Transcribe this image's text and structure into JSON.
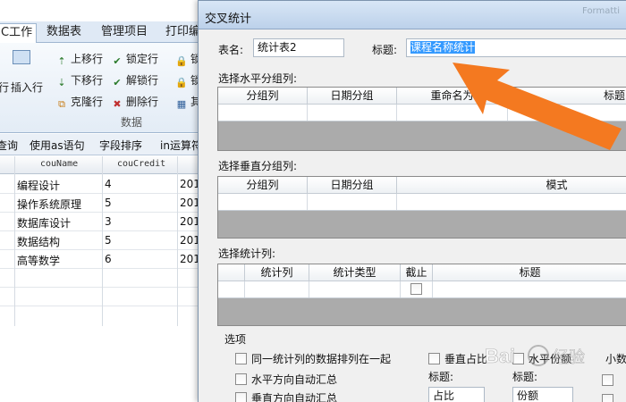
{
  "bg_app": {
    "tabs": [
      "C工作",
      "数据表",
      "管理项目",
      "打印编"
    ],
    "ribbon_left": [
      "行",
      "插入行"
    ],
    "ribbon_col1": [
      "上移行",
      "下移行",
      "克隆行"
    ],
    "ribbon_col2": [
      "锁定行",
      "解锁行",
      "删除行"
    ],
    "ribbon_col3": [
      "锁",
      "锁",
      "其"
    ],
    "ribbon_group_label": "数据",
    "query_bar": [
      "查询",
      "使用as语句",
      "字段排序",
      "in运算符"
    ],
    "grid_headers": [
      "couName",
      "couCredit"
    ],
    "rows": [
      {
        "name": "编程设计",
        "credit": "4",
        "extra": "201"
      },
      {
        "name": "操作系统原理",
        "credit": "5",
        "extra": "201"
      },
      {
        "name": "数据库设计",
        "credit": "3",
        "extra": "201"
      },
      {
        "name": "数据结构",
        "credit": "5",
        "extra": "201"
      },
      {
        "name": "高等数学",
        "credit": "6",
        "extra": "201"
      }
    ]
  },
  "dialog": {
    "title": "交叉统计",
    "title_faded": "Formatti",
    "table_name_label": "表名:",
    "table_name_value": "统计表2",
    "caption_label": "标题:",
    "caption_value": "课程名称统计",
    "horizontal": {
      "label": "选择水平分组列:",
      "columns": [
        "分组列",
        "日期分组",
        "重命名为",
        "标题"
      ]
    },
    "vertical": {
      "label": "选择垂直分组列:",
      "columns": [
        "分组列",
        "日期分组",
        "模式"
      ]
    },
    "stats": {
      "label": "选择统计列:",
      "columns": [
        "统计列",
        "统计类型",
        "截止",
        "标题"
      ]
    },
    "options": {
      "label": "选项",
      "items": [
        "同一统计列的数据排列在一起",
        "水平方向自动汇总",
        "垂直方向自动汇总",
        "垂直占比",
        "水平份额",
        "小数"
      ],
      "title_label": "标题:",
      "pct_title_value": "占比",
      "share_title_value": "份额"
    }
  },
  "colors": {
    "arrow": "#f47920",
    "selection": "#3399ff",
    "grid_empty": "#ababab"
  },
  "watermark": "Bai 经验"
}
